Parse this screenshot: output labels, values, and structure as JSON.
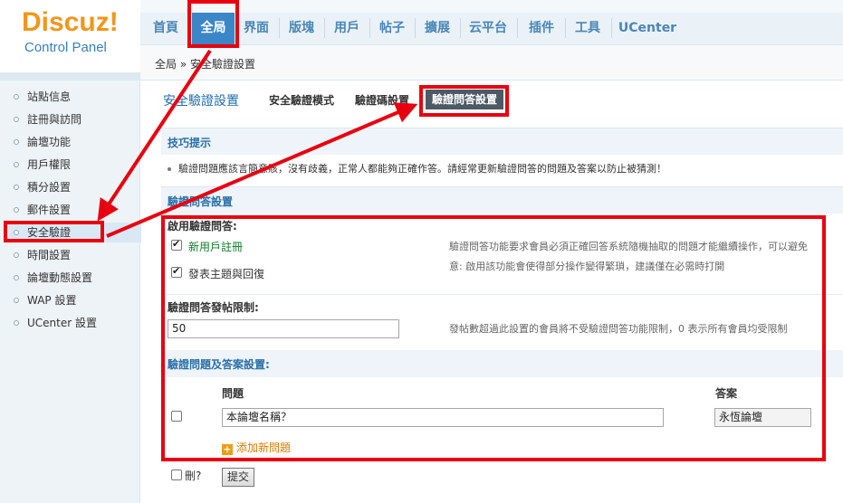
{
  "logo": {
    "title": "Discuz!",
    "subtitle": "Control Panel"
  },
  "topnav": {
    "items": [
      {
        "label": "首頁",
        "active": false
      },
      {
        "label": "全局",
        "active": true
      },
      {
        "label": "界面",
        "active": false
      },
      {
        "label": "版塊",
        "active": false
      },
      {
        "label": "用戶",
        "active": false
      },
      {
        "label": "帖子",
        "active": false
      },
      {
        "label": "擴展",
        "active": false
      },
      {
        "label": "云平台",
        "active": false
      },
      {
        "label": "插件",
        "active": false
      },
      {
        "label": "工具",
        "active": false
      },
      {
        "label": "UCenter",
        "active": false
      }
    ]
  },
  "breadcrumb": {
    "text": "全局 » 安全驗證設置"
  },
  "sidebar": {
    "items": [
      {
        "label": "站點信息"
      },
      {
        "label": "註冊與訪問"
      },
      {
        "label": "論壇功能"
      },
      {
        "label": "用戶權限"
      },
      {
        "label": "積分設置"
      },
      {
        "label": "郵件設置"
      },
      {
        "label": "安全驗證",
        "active": true
      },
      {
        "label": "時間設置"
      },
      {
        "label": "論壇動態設置"
      },
      {
        "label": "WAP 設置"
      },
      {
        "label": "UCenter 設置"
      }
    ]
  },
  "main": {
    "title": "安全驗證設置",
    "subtabs": [
      {
        "label": "安全驗證模式"
      },
      {
        "label": "驗證碼設置"
      },
      {
        "label": "驗證問答設置",
        "active": true
      }
    ],
    "tips": {
      "heading": "技巧提示",
      "text": "驗證問題應該言簡意賅，沒有歧義，正常人都能夠正確作答。請經常更新驗證問答的問題及答案以防止被猜測！"
    },
    "qa_settings": {
      "heading": "驗證問答設置",
      "enable_label": "啟用驗證問答:",
      "options": [
        {
          "label": "新用戶註冊",
          "checked": true
        },
        {
          "label": "發表主題與回復",
          "checked": true
        }
      ],
      "enable_hint_line1": "驗證問答功能要求會員必須正確回答系統隨機抽取的問題才能繼續操作，可以避免",
      "enable_hint_line2": "意: 啟用該功能會使得部分操作變得繁瑣，建議僅在必需時打開",
      "post_limit_label": "驗證問答發帖限制:",
      "post_limit_value": "50",
      "post_limit_hint": "發帖數超過此設置的會員將不受驗證問答功能限制，0 表示所有會員均受限制",
      "qa_list_label": "驗證問題及答案設置:",
      "col_question": "問題",
      "col_answer": "答案",
      "rows": [
        {
          "question": "本論壇名稱？",
          "answer": "永恆論壇",
          "checked": false
        }
      ],
      "add_label": "添加新問題",
      "delete_label": "刪?",
      "submit_label": "提交"
    }
  },
  "colors": {
    "accent": "#3b86c7",
    "annotation": "#e8000f",
    "logo_orange": "#f2961a"
  }
}
